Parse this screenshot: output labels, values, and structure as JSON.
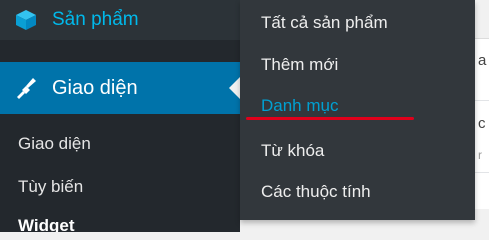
{
  "sidebar": {
    "products_label": "Sản phẩm",
    "products_icon": "cube-icon",
    "appearance_label": "Giao diện",
    "appearance_icon": "paintbrush-icon",
    "submenu": [
      {
        "label": "Giao diện"
      },
      {
        "label": "Tùy biến"
      },
      {
        "label": "Widget"
      }
    ]
  },
  "flyout": {
    "items": [
      {
        "label": "Tất cả sản phẩm"
      },
      {
        "label": "Thêm mới"
      },
      {
        "label": "Danh mục"
      },
      {
        "label": "Từ khóa"
      },
      {
        "label": "Các thuộc tính"
      }
    ],
    "active_index": 2
  },
  "content": {
    "fragments": [
      "a",
      "c",
      "r"
    ]
  },
  "colors": {
    "sidebar_bg": "#23282d",
    "active_bg": "#0073aa",
    "link_blue": "#00b9eb",
    "flyout_bg": "#32373c",
    "annotation_red": "#e0001b"
  }
}
